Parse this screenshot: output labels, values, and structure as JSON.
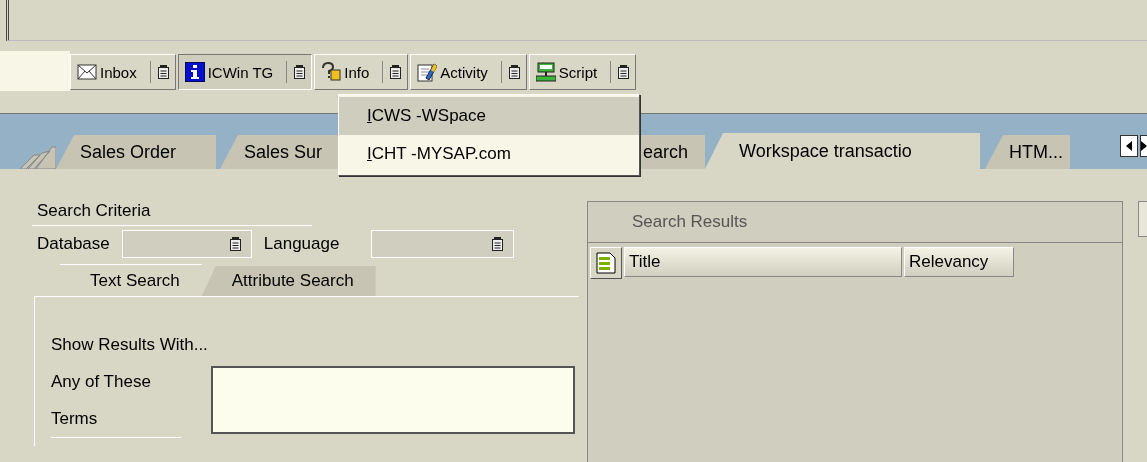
{
  "toolbar": {
    "buttons": [
      {
        "label": "Inbox",
        "kind": "envelope",
        "pressed": false
      },
      {
        "label": "ICWin TG",
        "kind": "info",
        "pressed": true
      },
      {
        "label": "Info",
        "kind": "help",
        "pressed": false
      },
      {
        "label": "Activity",
        "kind": "pencil",
        "pressed": false
      },
      {
        "label": "Script",
        "kind": "monitor",
        "pressed": false
      }
    ]
  },
  "menu": {
    "items": [
      {
        "label": "ICWS -WSpace",
        "selected": true
      },
      {
        "label": "ICHT -MYSAP.com",
        "selected": false
      }
    ]
  },
  "tabs": [
    {
      "label": "Sales Order",
      "selected": false
    },
    {
      "label": "Sales Sur",
      "selected": false
    },
    {
      "label": "earch",
      "selected": false
    },
    {
      "label": "Workspace transactio",
      "selected": true
    },
    {
      "label": "HTM...",
      "selected": false
    }
  ],
  "search_criteria": {
    "title": "Search Criteria",
    "fields": [
      {
        "label": "Database"
      },
      {
        "label": "Language"
      }
    ],
    "tabs": [
      {
        "label": "Text Search",
        "selected": true
      },
      {
        "label": "Attribute Search",
        "selected": false
      }
    ],
    "heading": "Show Results With...",
    "terms_label": "Any of These Terms"
  },
  "search_results": {
    "title": "Search Results",
    "columns": [
      "Title",
      "Relevancy"
    ]
  }
}
